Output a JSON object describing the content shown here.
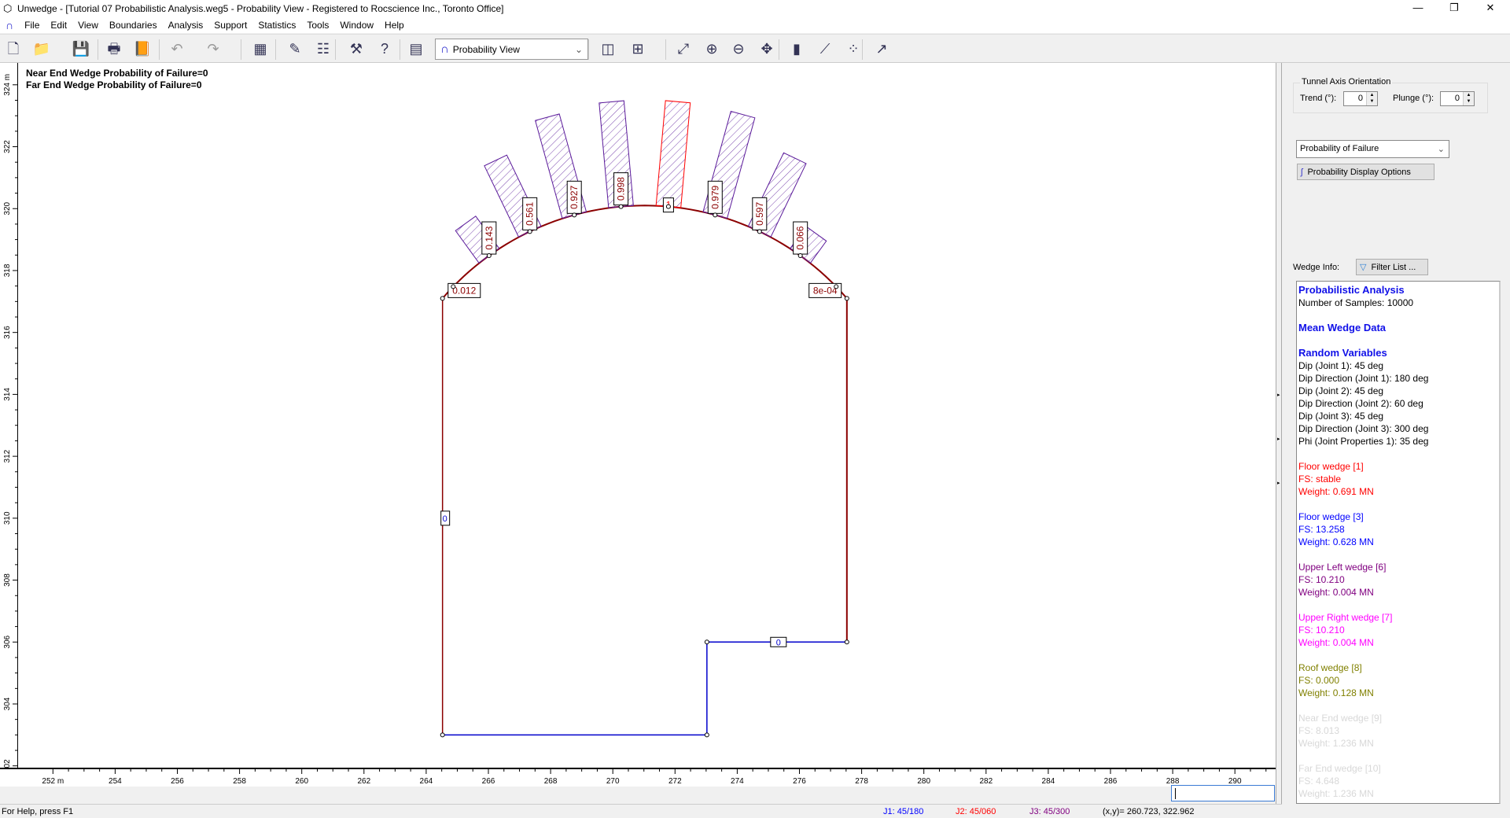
{
  "window": {
    "title": "Unwedge - [Tutorial 07 Probabilistic Analysis.weg5 - Probability View - Registered to Rocscience Inc., Toronto Office]"
  },
  "menu": [
    "File",
    "Edit",
    "View",
    "Boundaries",
    "Analysis",
    "Support",
    "Statistics",
    "Tools",
    "Window",
    "Help"
  ],
  "toolbar": {
    "view_select": "Probability View",
    "icons": [
      "new-file-icon",
      "open-folder-icon",
      "save-icon",
      "print-icon",
      "export-icon",
      "undo-icon",
      "redo-icon",
      "color-grid-icon",
      "edit-icon",
      "settings-sheet-icon",
      "wedge-compute-icon",
      "info-query-icon",
      "calculator-icon",
      "layout-icon",
      "add-view-icon",
      "zoom-extents-icon",
      "zoom-in-icon",
      "zoom-out-icon",
      "pan-icon",
      "bar-chart-icon",
      "line-chart-icon",
      "scatter-icon",
      "arrow-icon"
    ]
  },
  "plot": {
    "overlay": [
      "Near End Wedge Probability of Failure=0",
      "Far End Wedge Probability of Failure=0"
    ],
    "x_axis": {
      "unit": "m",
      "min": 252,
      "max": 290,
      "step": 2
    },
    "y_axis": {
      "unit": "m",
      "min": 302,
      "max": 324,
      "step": 2
    },
    "tunnel": {
      "left": 264.5,
      "right": 277.5,
      "floor": 303,
      "step_x": 273,
      "step_y": 306,
      "wall_top": 317.1,
      "crown": 320.1
    },
    "roof_probabilities": [
      "0.012",
      "0.143",
      "0.561",
      "0.927",
      "0.998",
      "1",
      "0.979",
      "0.597",
      "0.066",
      "8e-04"
    ],
    "wall_label": "0",
    "floor_label": "0",
    "colors": {
      "tunnel": "#8b0000",
      "floor_blue": "#0000cc",
      "bar": "#5a1a9a",
      "bar_fail": "#ff0000",
      "label": "#8b0000"
    }
  },
  "panel": {
    "group_title": "Tunnel Axis Orientation",
    "trend_label": "Trend (°):",
    "trend": "0",
    "plunge_label": "Plunge (°):",
    "plunge": "0",
    "display_select": "Probability of Failure",
    "display_options": "Probability Display Options",
    "wedge_info_label": "Wedge Info:",
    "filter_button": "Filter List ...",
    "info": [
      {
        "t": "Probabilistic Analysis",
        "c": "h"
      },
      {
        "t": "Number of Samples: 10000"
      },
      {
        "t": ""
      },
      {
        "t": "Mean Wedge Data",
        "c": "h"
      },
      {
        "t": ""
      },
      {
        "t": "Random Variables",
        "c": "h"
      },
      {
        "t": "Dip (Joint 1): 45 deg"
      },
      {
        "t": "Dip Direction (Joint 1): 180 deg"
      },
      {
        "t": "Dip (Joint 2): 45 deg"
      },
      {
        "t": "Dip Direction (Joint 2): 60 deg"
      },
      {
        "t": "Dip (Joint 3): 45 deg"
      },
      {
        "t": "Dip Direction (Joint 3): 300 deg"
      },
      {
        "t": "Phi (Joint Properties 1): 35 deg"
      },
      {
        "t": ""
      },
      {
        "t": "Floor wedge [1]",
        "col": "#ff0000"
      },
      {
        "t": "FS: stable",
        "col": "#ff0000"
      },
      {
        "t": "Weight: 0.691 MN",
        "col": "#ff0000"
      },
      {
        "t": ""
      },
      {
        "t": "Floor wedge [3]",
        "col": "#0000ff"
      },
      {
        "t": "FS: 13.258",
        "col": "#0000ff"
      },
      {
        "t": "Weight: 0.628 MN",
        "col": "#0000ff"
      },
      {
        "t": ""
      },
      {
        "t": "Upper Left wedge [6]",
        "col": "#800080"
      },
      {
        "t": "FS: 10.210",
        "col": "#800080"
      },
      {
        "t": "Weight: 0.004 MN",
        "col": "#800080"
      },
      {
        "t": ""
      },
      {
        "t": "Upper Right wedge [7]",
        "col": "#ff00ff"
      },
      {
        "t": "FS: 10.210",
        "col": "#ff00ff"
      },
      {
        "t": "Weight: 0.004 MN",
        "col": "#ff00ff"
      },
      {
        "t": ""
      },
      {
        "t": "Roof wedge [8]",
        "col": "#808000"
      },
      {
        "t": "FS: 0.000",
        "col": "#808000"
      },
      {
        "t": "Weight: 0.128 MN",
        "col": "#808000"
      },
      {
        "t": ""
      },
      {
        "t": "Near End wedge [9]",
        "col": "#d8d8d8"
      },
      {
        "t": "FS: 8.013",
        "col": "#d8d8d8"
      },
      {
        "t": "Weight: 1.236 MN",
        "col": "#d8d8d8"
      },
      {
        "t": ""
      },
      {
        "t": "Far End wedge [10]",
        "col": "#d8d8d8"
      },
      {
        "t": "FS: 4.648",
        "col": "#d8d8d8"
      },
      {
        "t": "Weight: 1.236 MN",
        "col": "#d8d8d8"
      }
    ]
  },
  "status": {
    "help": "For Help, press F1",
    "j1": "J1: 45/180",
    "j2": "J2: 45/060",
    "j3": "J3: 45/300",
    "xy": "(x,y)= 260.723, 322.962"
  }
}
